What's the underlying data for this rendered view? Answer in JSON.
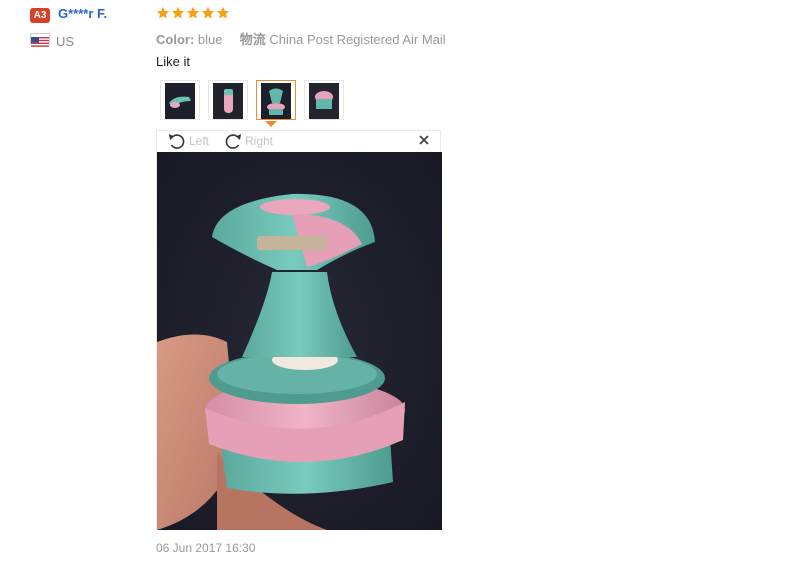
{
  "user": {
    "level_badge": "A3",
    "name": "G****r F.",
    "country_code": "US"
  },
  "review": {
    "rating": 5,
    "color_label": "Color:",
    "color_value": "blue",
    "logistics_label": "物流",
    "logistics_value": "China Post Registered Air Mail",
    "comment": "Like it",
    "date": "06 Jun 2017 16:30"
  },
  "viewer": {
    "rotate_left_label": "Left",
    "rotate_right_label": "Right"
  },
  "colors": {
    "star": "#f6a01a",
    "name_link": "#2a63c7",
    "badge": "#d8402a",
    "thumb_selected": "#f08a2a",
    "photo_bg": "#1d1f2a",
    "product_teal": "#63b8ab",
    "product_pink": "#e7a1b9"
  },
  "thumbnails": [
    {
      "icon": "product-side-thumb",
      "selected": false
    },
    {
      "icon": "product-pink-thumb",
      "selected": false
    },
    {
      "icon": "product-open-thumb",
      "selected": true
    },
    {
      "icon": "product-closed-thumb",
      "selected": false
    }
  ]
}
